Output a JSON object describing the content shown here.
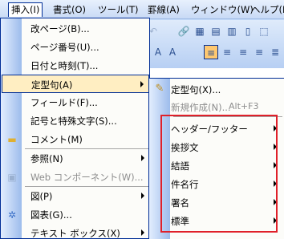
{
  "menubar": {
    "items": [
      {
        "label": "挿入(I)"
      },
      {
        "label": "書式(O)"
      },
      {
        "label": "ツール(T)"
      },
      {
        "label": "罫線(A)"
      },
      {
        "label": "ウィンドウ(W)"
      },
      {
        "label": "ヘルプ(H)"
      }
    ]
  },
  "insert_menu": {
    "items": [
      {
        "label": "改ページ(B)..."
      },
      {
        "label": "ページ番号(U)..."
      },
      {
        "label": "日付と時刻(T)..."
      },
      {
        "label": "定型句(A)"
      },
      {
        "label": "フィールド(F)..."
      },
      {
        "label": "記号と特殊文字(S)..."
      },
      {
        "label": "コメント(M)"
      },
      {
        "label": "参照(N)"
      },
      {
        "label": "Web コンポーネント(W)..."
      },
      {
        "label": "図(P)"
      },
      {
        "label": "図表(G)..."
      },
      {
        "label": "テキスト ボックス(X)"
      }
    ]
  },
  "autotext_submenu": {
    "items": [
      {
        "label": "定型句(X)..."
      },
      {
        "label": "新規作成(N)...",
        "shortcut": "Alt+F3"
      },
      {
        "label": "ヘッダー/フッター"
      },
      {
        "label": "挨拶文"
      },
      {
        "label": "結語"
      },
      {
        "label": "件名行"
      },
      {
        "label": "署名"
      },
      {
        "label": "標準"
      }
    ]
  },
  "colors": {
    "highlight": "#ffeec2",
    "border": "#002d96",
    "red_box": "#e0202a"
  }
}
